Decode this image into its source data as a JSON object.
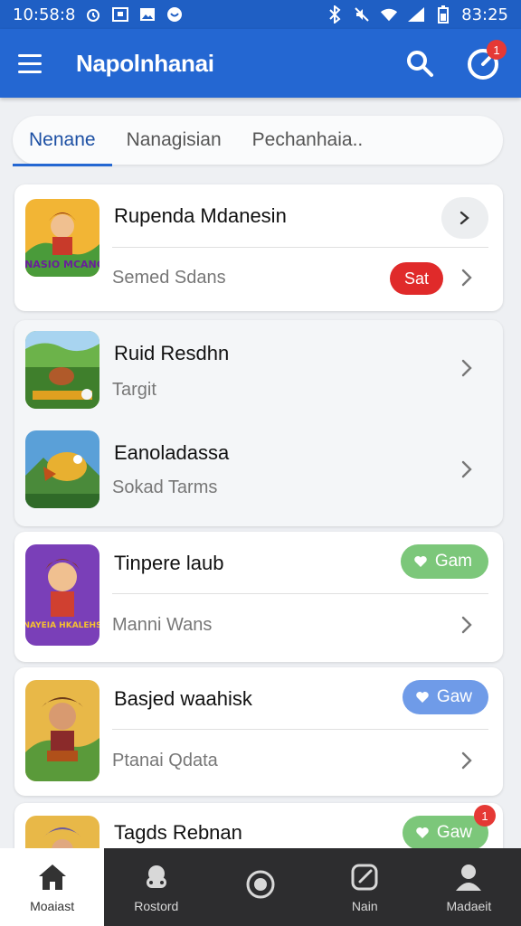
{
  "status_bar": {
    "time_left": "10:58:8",
    "time_right": "83:25"
  },
  "app_bar": {
    "title": "Napolnhanai",
    "notification_count": "1"
  },
  "tabs": [
    {
      "label": "Nenane",
      "active": true
    },
    {
      "label": "Nanagisian",
      "active": false
    },
    {
      "label": "Pechanhaia..",
      "active": false
    }
  ],
  "cards": [
    {
      "name": "Rupenda Mdanesin",
      "subtitle": "Semed Sdans",
      "tag": "Sat",
      "tag_color": "#e02a2a",
      "thumb_text": "MANASIO MCANCAL"
    },
    {
      "name": "Ruid Resdhn",
      "subtitle": "Targit"
    },
    {
      "name": "Eanoladassa",
      "subtitle": "Sokad Tarms"
    },
    {
      "name": "Tinpere laub",
      "subtitle": "Manni Wans",
      "tag": "Gam",
      "tag_color": "#7cc77a",
      "thumb_text": "NAYEIA HKALEHS"
    },
    {
      "name": "Basjed waahisk",
      "subtitle": "Ptanai Qdata",
      "tag": "Gaw",
      "tag_color": "#6f9be8"
    },
    {
      "name": "Tagds Rebnan",
      "tag": "Gaw",
      "tag_color": "#7cc77a",
      "tag_badge": "1"
    }
  ],
  "bottom_nav": [
    {
      "label": "Moaiast",
      "icon": "home-icon",
      "active": true
    },
    {
      "label": "Rostord",
      "icon": "gamepad-icon",
      "active": false
    },
    {
      "label": "",
      "icon": "record-icon",
      "active": false
    },
    {
      "label": "Nain",
      "icon": "edit-icon",
      "active": false
    },
    {
      "label": "Madaeit",
      "icon": "profile-icon",
      "active": false
    }
  ],
  "colors": {
    "primary": "#2467d2",
    "status_bar": "#1f5fc4",
    "red_tag": "#e02a2a",
    "green_tag": "#7cc77a",
    "blue_tag": "#6f9be8"
  }
}
